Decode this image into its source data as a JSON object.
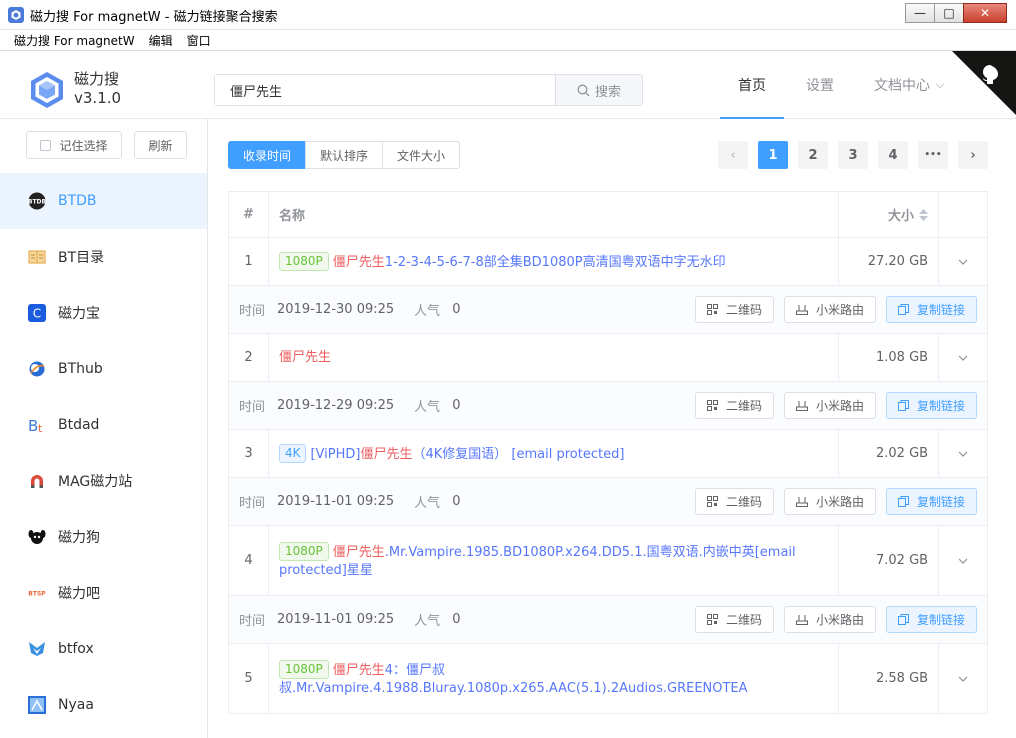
{
  "window": {
    "title": "磁力搜 For magnetW - 磁力链接聚合搜索",
    "min": "—",
    "max": "□",
    "close": "✕"
  },
  "menu": [
    "磁力搜 For magnetW",
    "编辑",
    "窗口"
  ],
  "app": {
    "name": "磁力搜",
    "version": "v3.1.0"
  },
  "search": {
    "value": "僵尸先生",
    "button": "搜索"
  },
  "nav": [
    "首页",
    "设置",
    "文档中心"
  ],
  "nav_chevron": "⌵",
  "sidebar": {
    "remember": "记住选择",
    "refresh": "刷新",
    "items": [
      {
        "label": "BTDB",
        "icon": "btdb-icon",
        "color": "#222222"
      },
      {
        "label": "BT目录",
        "icon": "book-icon",
        "color": "#e6a23c"
      },
      {
        "label": "磁力宝",
        "icon": "c-letter-icon",
        "color": "#1a5ce0"
      },
      {
        "label": "BThub",
        "icon": "globe-icon",
        "color": "#2a6bd8"
      },
      {
        "label": "Btdad",
        "icon": "bt-letter-icon",
        "color": "#3d7be0"
      },
      {
        "label": "MAG磁力站",
        "icon": "magnet-icon",
        "color": "#d94a3a"
      },
      {
        "label": "磁力狗",
        "icon": "dog-icon",
        "color": "#111111"
      },
      {
        "label": "磁力吧",
        "icon": "btsp-icon",
        "color": "#ee6633"
      },
      {
        "label": "btfox",
        "icon": "fox-icon",
        "color": "#3a8fe0"
      },
      {
        "label": "Nyaa",
        "icon": "nyaa-icon",
        "color": "#2a6fd8"
      }
    ]
  },
  "sort": [
    "收录时间",
    "默认排序",
    "文件大小"
  ],
  "pager": {
    "prev": "‹",
    "pages": [
      "1",
      "2",
      "3",
      "4"
    ],
    "more": "•••",
    "next": "›"
  },
  "table": {
    "headers": {
      "index": "#",
      "name": "名称",
      "size": "大小"
    },
    "meta_labels": {
      "time": "时间",
      "popularity": "人气"
    },
    "actions": {
      "qrcode": "二维码",
      "router": "小米路由",
      "copy": "复制链接"
    },
    "rows": [
      {
        "index": "1",
        "tag": "1080P",
        "tag_style": "g",
        "prefix": "",
        "highlight": "僵尸先生",
        "suffix": "1-2-3-4-5-6-7-8部全集BD1080P高清国粤双语中字无水印",
        "size": "27.20 GB",
        "time": "2019-12-30 09:25",
        "popularity": "0"
      },
      {
        "index": "2",
        "tag": "",
        "tag_style": "",
        "prefix": "",
        "highlight": "僵尸先生",
        "suffix": "",
        "size": "1.08 GB",
        "time": "2019-12-29 09:25",
        "popularity": "0"
      },
      {
        "index": "3",
        "tag": "4K",
        "tag_style": "b",
        "prefix": "[ViPHD]",
        "highlight": "僵尸先生",
        "suffix": "（4K修复国语） [email protected]",
        "size": "2.02 GB",
        "time": "2019-11-01 09:25",
        "popularity": "0"
      },
      {
        "index": "4",
        "tag": "1080P",
        "tag_style": "g",
        "prefix": "",
        "highlight": "僵尸先生",
        "suffix": ".Mr.Vampire.1985.BD1080P.x264.DD5.1.国粤双语.内嵌中英[email protected]星星",
        "size": "7.02 GB",
        "time": "2019-11-01 09:25",
        "popularity": "0"
      },
      {
        "index": "5",
        "tag": "1080P",
        "tag_style": "g",
        "prefix": "",
        "highlight": "僵尸先生",
        "suffix": "4：僵尸叔叔.Mr.Vampire.4.1988.Bluray.1080p.x265.AAC(5.1).2Audios.GREENOTEA",
        "size": "2.58 GB",
        "time": "",
        "popularity": ""
      }
    ]
  },
  "colors": {
    "accent": "#409eff",
    "highlight": "#ee5e5e",
    "link": "#5677fc"
  }
}
